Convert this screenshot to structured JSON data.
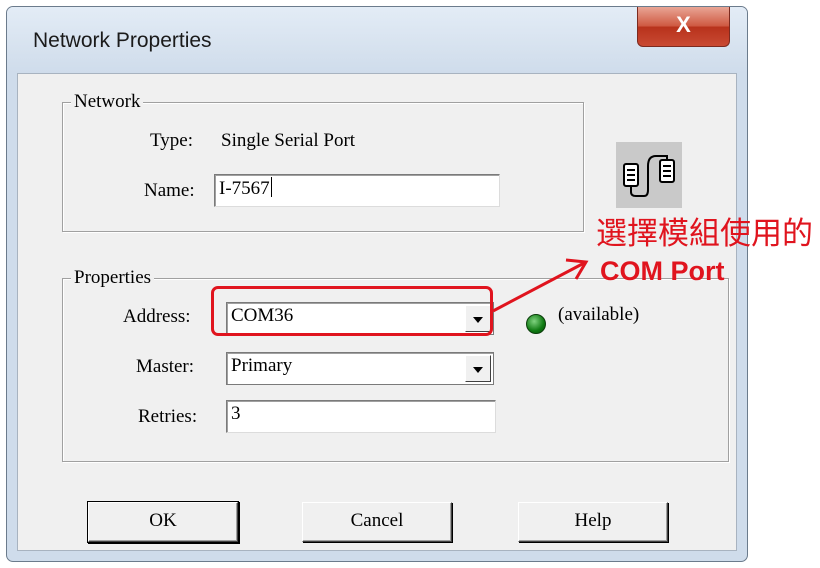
{
  "window": {
    "title": "Network Properties",
    "close_label": "X"
  },
  "network_group": {
    "legend": "Network",
    "type_label": "Type:",
    "type_value": "Single Serial Port",
    "name_label": "Name:",
    "name_value": "I-7567"
  },
  "properties_group": {
    "legend": "Properties",
    "address_label": "Address:",
    "address_value": "COM36",
    "address_status": "(available)",
    "master_label": "Master:",
    "master_value": "Primary",
    "retries_label": "Retries:",
    "retries_value": "3"
  },
  "buttons": {
    "ok": "OK",
    "cancel": "Cancel",
    "help": "Help"
  },
  "annotation": {
    "line1": "選擇模組使用的",
    "line2": "COM Port",
    "color": "#e0141e"
  },
  "icons": {
    "network": "serial-network-icon",
    "status": "green-led-icon"
  }
}
